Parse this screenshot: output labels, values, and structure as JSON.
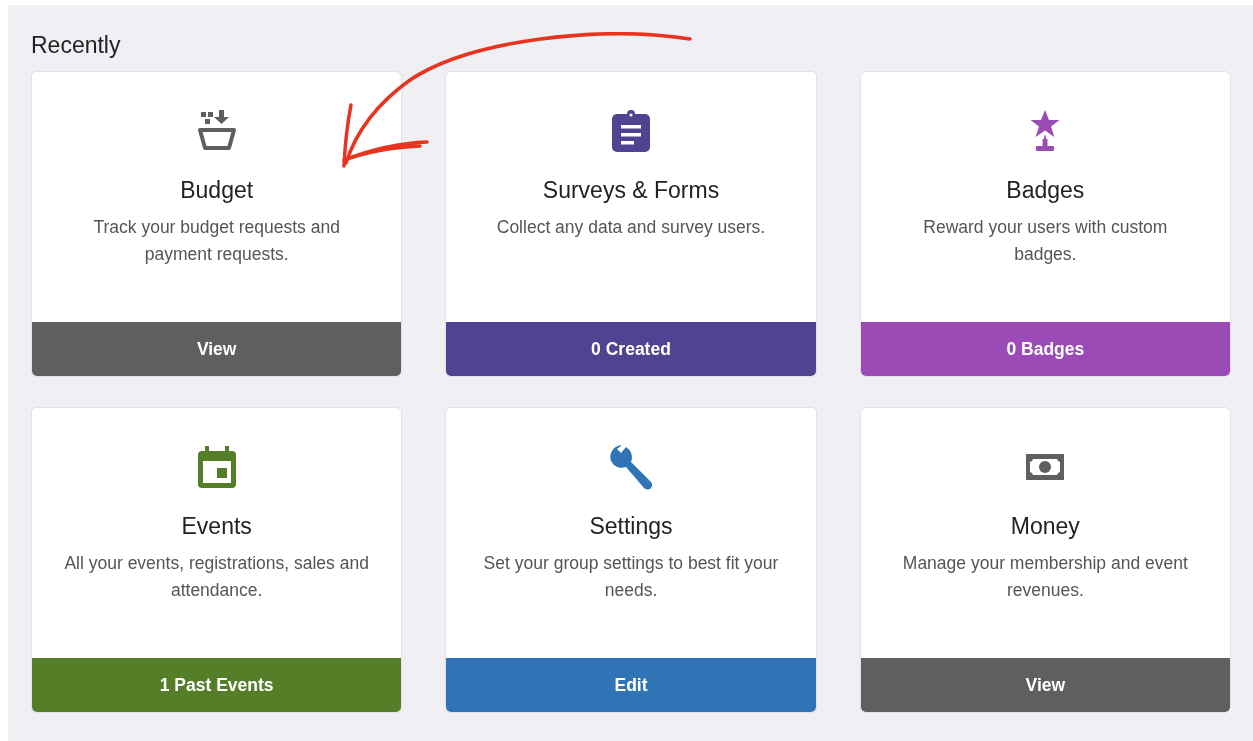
{
  "section_title": "Recently",
  "cards": [
    {
      "kind": "inbox",
      "title": "Budget",
      "description": "Track your budget requests and payment requests.",
      "button": "View",
      "color": "#5f5f5f"
    },
    {
      "kind": "clipboard",
      "title": "Surveys & Forms",
      "description": "Collect any data and survey users.",
      "button": "0 Created",
      "color": "#4f4491"
    },
    {
      "kind": "trophy",
      "title": "Badges",
      "description": "Reward your users with custom badges.",
      "button": "0 Badges",
      "color": "#9a4bb6"
    },
    {
      "kind": "calendar",
      "title": "Events",
      "description": "All your events, registrations, sales and attendance.",
      "button": "1 Past Events",
      "color": "#547f28"
    },
    {
      "kind": "wrench",
      "title": "Settings",
      "description": "Set your group settings to best fit your needs.",
      "button": "Edit",
      "color": "#3174b5"
    },
    {
      "kind": "money",
      "title": "Money",
      "description": "Manage your membership and event revenues.",
      "button": "View",
      "color": "#5f5f5f"
    }
  ]
}
